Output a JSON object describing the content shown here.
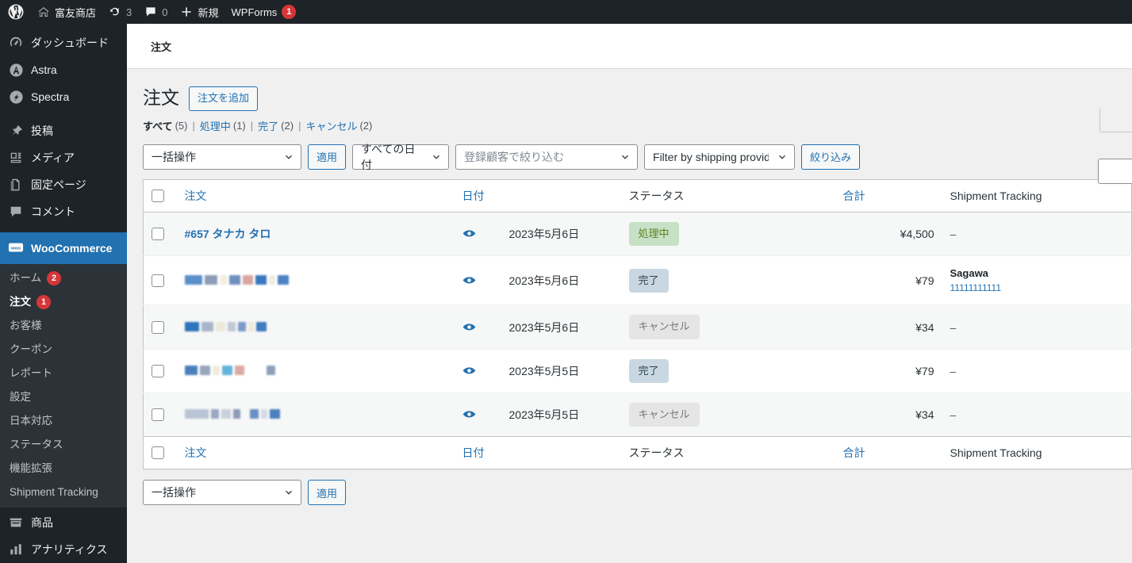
{
  "adminbar": {
    "logo_icon": "wordpress-logo-icon",
    "site_icon": "home-icon",
    "site_name": "富友商店",
    "updates_icon": "updates-icon",
    "updates_count": "3",
    "comments_icon": "comment-bubble-icon",
    "comments_count": "0",
    "new_icon": "plus-icon",
    "new_label": "新規",
    "wpforms_label": "WPForms",
    "wpforms_badge": "1"
  },
  "sidebar": {
    "items": [
      {
        "label": "ダッシュボード",
        "icon": "dashboard-icon",
        "name": "dashboard"
      },
      {
        "label": "Astra",
        "icon": "astra-icon",
        "name": "astra"
      },
      {
        "label": "Spectra",
        "icon": "spectra-icon",
        "name": "spectra"
      },
      {
        "label": "投稿",
        "icon": "pin-icon",
        "name": "posts"
      },
      {
        "label": "メディア",
        "icon": "media-icon",
        "name": "media"
      },
      {
        "label": "固定ページ",
        "icon": "pages-icon",
        "name": "pages"
      },
      {
        "label": "コメント",
        "icon": "comments-icon",
        "name": "comments"
      },
      {
        "label": "WooCommerce",
        "icon": "woocommerce-icon",
        "name": "woocommerce",
        "current": true
      }
    ],
    "submenu": [
      {
        "label": "ホーム",
        "badge": "2",
        "name": "home"
      },
      {
        "label": "注文",
        "badge": "1",
        "name": "orders",
        "current": true
      },
      {
        "label": "お客様",
        "name": "customers"
      },
      {
        "label": "クーポン",
        "name": "coupons"
      },
      {
        "label": "レポート",
        "name": "reports"
      },
      {
        "label": "設定",
        "name": "settings"
      },
      {
        "label": "日本対応",
        "name": "japanized"
      },
      {
        "label": "ステータス",
        "name": "status"
      },
      {
        "label": "機能拡張",
        "name": "extensions"
      },
      {
        "label": "Shipment Tracking",
        "name": "shipment-tracking"
      }
    ],
    "bottom_items": [
      {
        "label": "商品",
        "icon": "products-icon",
        "name": "products"
      },
      {
        "label": "アナリティクス",
        "icon": "analytics-icon",
        "name": "analytics"
      }
    ]
  },
  "breadcrumb": "注文",
  "page": {
    "title": "注文",
    "add_button": "注文を追加"
  },
  "status_filters": [
    {
      "label": "すべて",
      "count": "(5)",
      "current": true
    },
    {
      "label": "処理中",
      "count": "(1)"
    },
    {
      "label": "完了",
      "count": "(2)"
    },
    {
      "label": "キャンセル",
      "count": "(2)"
    }
  ],
  "toolbar": {
    "bulk_action": "一括操作",
    "apply_label": "適用",
    "date_filter": "すべての日付",
    "customer_placeholder": "登録顧客で絞り込む",
    "shipping_filter": "Filter by shipping provider",
    "filter_label": "絞り込み"
  },
  "table": {
    "columns": [
      {
        "key": "cb",
        "label": ""
      },
      {
        "key": "order",
        "label": "注文",
        "sortable": true
      },
      {
        "key": "date",
        "label": "日付",
        "sortable": true
      },
      {
        "key": "status",
        "label": "ステータス",
        "sortable": false
      },
      {
        "key": "total",
        "label": "合計",
        "sortable": true
      },
      {
        "key": "tracking",
        "label": "Shipment Tracking",
        "sortable": false
      }
    ],
    "rows": [
      {
        "order": "#657 タナカ タロ",
        "redacted": false,
        "preview_icon": "eye-preview-icon",
        "date": "2023年5月6日",
        "status": "処理中",
        "status_type": "processing",
        "total": "¥4,500",
        "tracking_provider": "",
        "tracking_number": "",
        "tracking_dash": "–"
      },
      {
        "order": "",
        "redacted": true,
        "preview_icon": "eye-preview-icon",
        "date": "2023年5月6日",
        "status": "完了",
        "status_type": "completed",
        "total": "¥79",
        "tracking_provider": "Sagawa",
        "tracking_number": "11111111111",
        "tracking_dash": ""
      },
      {
        "order": "",
        "redacted": true,
        "preview_icon": "eye-preview-icon",
        "date": "2023年5月6日",
        "status": "キャンセル",
        "status_type": "cancelled",
        "total": "¥34",
        "tracking_provider": "",
        "tracking_number": "",
        "tracking_dash": "–"
      },
      {
        "order": "",
        "redacted": true,
        "preview_icon": "eye-preview-icon",
        "date": "2023年5月5日",
        "status": "完了",
        "status_type": "completed",
        "total": "¥79",
        "tracking_provider": "",
        "tracking_number": "",
        "tracking_dash": "–"
      },
      {
        "order": "",
        "redacted": true,
        "preview_icon": "eye-preview-icon",
        "date": "2023年5月5日",
        "status": "キャンセル",
        "status_type": "cancelled",
        "total": "¥34",
        "tracking_provider": "",
        "tracking_number": "",
        "tracking_dash": "–"
      }
    ]
  },
  "toolbar_bottom": {
    "bulk_action": "一括操作",
    "apply_label": "適用"
  },
  "colors": {
    "accent": "#2271b1",
    "admin_bg": "#1d2327",
    "submenu_bg": "#2c3338",
    "badge_red": "#d63638",
    "status_processing_bg": "#c6e1c6",
    "status_completed_bg": "#c8d7e1",
    "status_cancelled_bg": "#e5e5e5"
  }
}
